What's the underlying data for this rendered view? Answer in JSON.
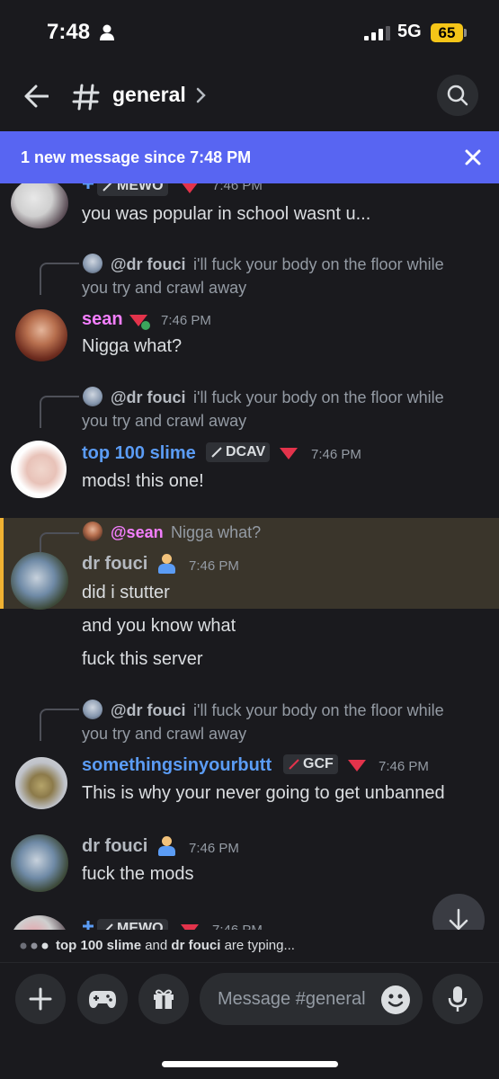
{
  "status": {
    "time": "7:48",
    "network": "5G",
    "battery": "65"
  },
  "header": {
    "channel": "general"
  },
  "banner": {
    "text": "1 new message since 7:48 PM"
  },
  "messages": [
    {
      "partial_top": true,
      "tag": "MEWO",
      "time": "7:46 PM",
      "lines": [
        "you was popular in school wasnt u..."
      ]
    },
    {
      "reply": {
        "name": "@dr fouci",
        "text": "i'll fuck your body on the floor while",
        "text2": "you try and crawl away"
      },
      "author": "sean",
      "author_color": "#f47fff",
      "time": "7:46 PM",
      "lines": [
        "Nigga what?"
      ]
    },
    {
      "reply": {
        "name": "@dr fouci",
        "text": "i'll fuck your body on the floor while",
        "text2": "you try and crawl away"
      },
      "author": "top 100 slime",
      "author_color": "#5b9cf5",
      "tag": "DCAV",
      "time": "7:46 PM",
      "lines": [
        "mods! this one!"
      ]
    },
    {
      "reply": {
        "name": "@sean",
        "text": "Nigga what?"
      },
      "author": "dr fouci",
      "author_color": "#b5bac1",
      "time": "7:46 PM",
      "lines": [
        "did i stutter",
        "and you know what",
        "fuck this server"
      ]
    },
    {
      "reply": {
        "name": "@dr fouci",
        "text": "i'll fuck your body on the floor while",
        "text2": "you try and crawl away"
      },
      "author": "somethingsinyourbutt",
      "author_color": "#5b9cf5",
      "tag": "GCF",
      "time": "7:46 PM",
      "lines": [
        "This is why your never going to get unbanned"
      ]
    },
    {
      "author": "dr fouci",
      "author_color": "#b5bac1",
      "time": "7:46 PM",
      "lines": [
        "fuck the mods"
      ]
    },
    {
      "partial_bottom": true,
      "tag": "MEWO",
      "time": "7:46 PM"
    }
  ],
  "typing": {
    "name1": "top 100 slime",
    "joiner": " and ",
    "name2": "dr fouci",
    "suffix": " are typing..."
  },
  "composer": {
    "placeholder": "Message #general"
  },
  "colors": {
    "accent": "#5865f2",
    "highlight": "#3a352b",
    "highlight_bar": "#f0b232"
  }
}
